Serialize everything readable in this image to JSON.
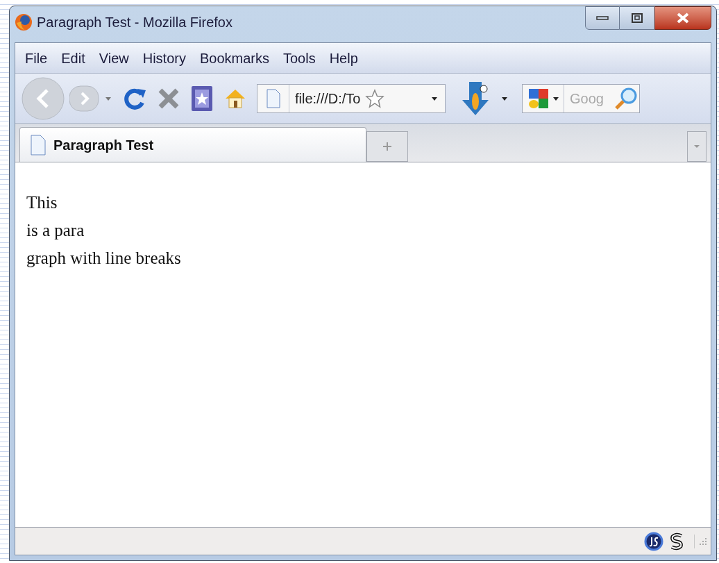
{
  "window": {
    "title": "Paragraph Test - Mozilla Firefox"
  },
  "menu": [
    "File",
    "Edit",
    "View",
    "History",
    "Bookmarks",
    "Tools",
    "Help"
  ],
  "toolbar": {
    "address": "file:///D:/To",
    "search_placeholder": "Goog"
  },
  "tabs": [
    {
      "label": "Paragraph Test",
      "selected": true
    }
  ],
  "content": {
    "lines": [
      "This",
      "is a para",
      "graph with line breaks"
    ]
  }
}
